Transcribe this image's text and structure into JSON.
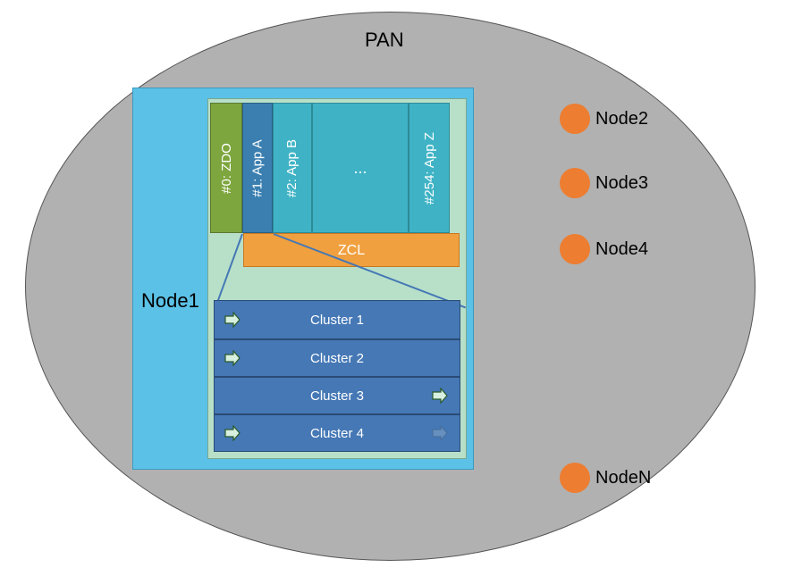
{
  "pan": {
    "title": "PAN"
  },
  "node1": {
    "label": "Node1",
    "endpoints": {
      "zdo": "#0: ZDO",
      "app_a": "#1: App A",
      "app_b": "#2: App B",
      "dots": "...",
      "app_z": "#254: App Z"
    },
    "zcl": "ZCL",
    "clusters": [
      {
        "label": "Cluster 1",
        "in": true,
        "out": false
      },
      {
        "label": "Cluster 2",
        "in": true,
        "out": false
      },
      {
        "label": "Cluster 3",
        "in": false,
        "out": true
      },
      {
        "label": "Cluster 4",
        "in": true,
        "out": true
      }
    ]
  },
  "nodes": {
    "n2": "Node2",
    "n3": "Node3",
    "n4": "Node4",
    "nN": "NodeN"
  },
  "colors": {
    "ellipse": "#b1b1b1",
    "node1_bg": "#5cc1e6",
    "inner_bg": "#b8e0c9",
    "zdo": "#7da63e",
    "app_a": "#3a7fb0",
    "app_rest": "#3fb3c5",
    "zcl": "#f0a03f",
    "cluster": "#4578b5",
    "node_dot": "#ed7d31"
  }
}
